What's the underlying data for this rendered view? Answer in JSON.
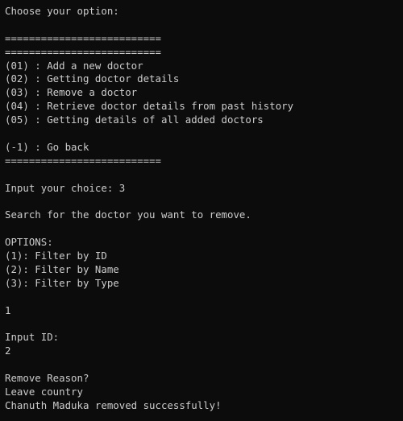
{
  "terminal": {
    "lines": [
      "Choose your option:",
      "",
      "==========================",
      "==========================",
      "(01) : Add a new doctor",
      "(02) : Getting doctor details",
      "(03) : Remove a doctor",
      "(04) : Retrieve doctor details from past history",
      "(05) : Getting details of all added doctors",
      "",
      "(-1) : Go back",
      "==========================",
      "",
      "Input your choice: 3",
      "",
      "Search for the doctor you want to remove.",
      "",
      "OPTIONS:",
      "(1): Filter by ID",
      "(2): Filter by Name",
      "(3): Filter by Type",
      "",
      "1",
      "",
      "Input ID:",
      "2",
      "",
      "Remove Reason?",
      "Leave country",
      "Chanuth Maduka removed successfully!"
    ]
  }
}
